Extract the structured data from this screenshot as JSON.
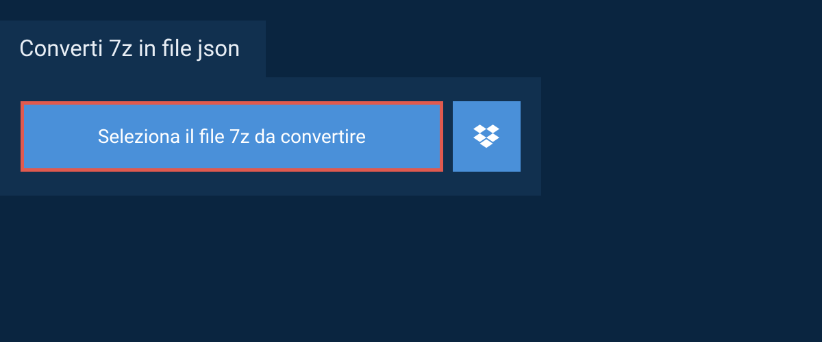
{
  "header": {
    "title": "Converti 7z in file json"
  },
  "actions": {
    "select_file_label": "Seleziona il file 7z da convertire"
  },
  "colors": {
    "page_bg": "#0a2540",
    "panel_bg": "#11304f",
    "button_bg": "#4a90d9",
    "button_border": "#e05a4f",
    "text_light": "#e8eef5"
  }
}
